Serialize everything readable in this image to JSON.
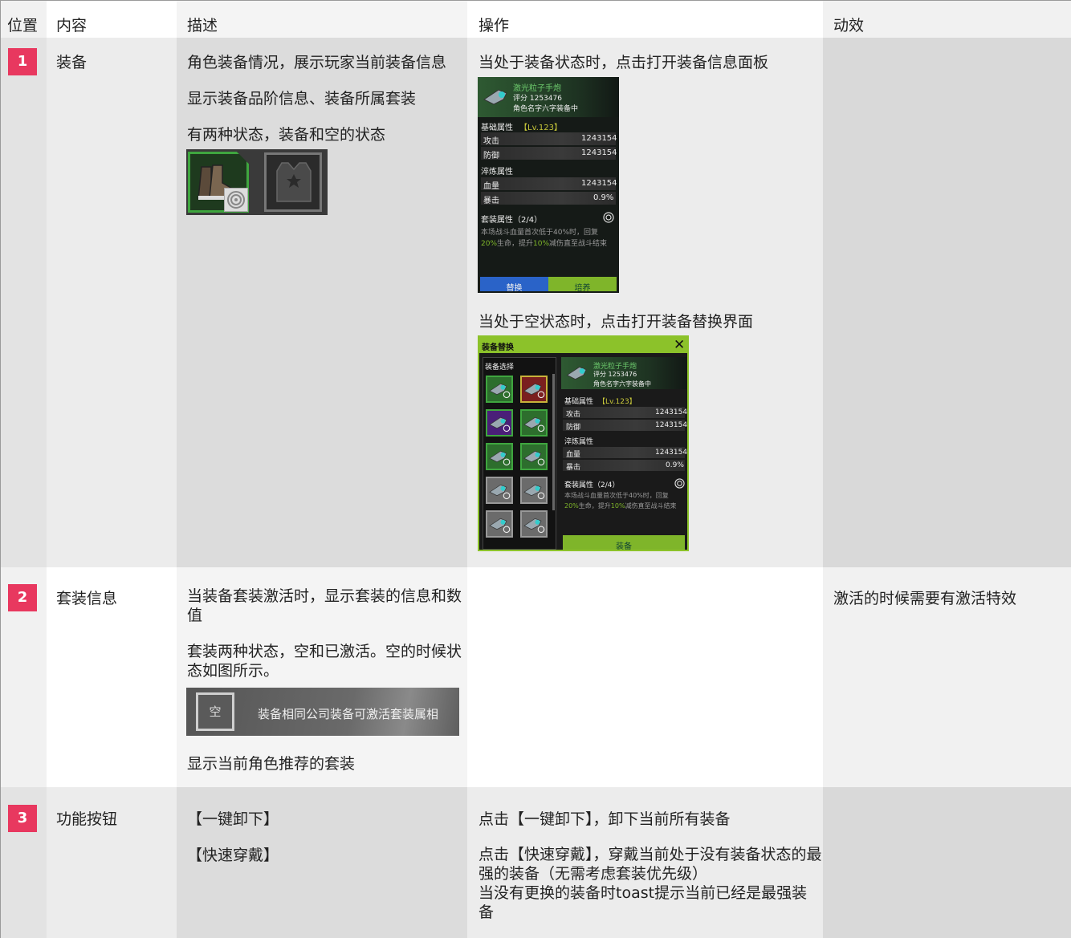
{
  "header": {
    "pos": "位置",
    "content": "内容",
    "desc": "描述",
    "op": "操作",
    "anim": "动效"
  },
  "rows": [
    {
      "num": "1",
      "content": "装备",
      "desc": [
        "角色装备情况，展示玩家当前装备信息",
        "显示装备品阶信息、装备所属套装",
        "有两种状态，装备和空的状态"
      ],
      "op": [
        "当处于装备状态时，点击打开装备信息面板",
        "当处于空状态时，点击打开装备替换界面"
      ],
      "anim": ""
    },
    {
      "num": "2",
      "content": "套装信息",
      "desc": [
        "当装备套装激活时，显示套装的信息和数值",
        "套装两种状态，空和已激活。空的时候状态如图所示。",
        "显示当前角色推荐的套装"
      ],
      "op": [],
      "anim": "激活的时候需要有激活特效"
    },
    {
      "num": "3",
      "content": "功能按钮",
      "desc": [
        "【一键卸下】",
        "【快速穿戴】"
      ],
      "op": [
        "点击【一键卸下】，卸下当前所有装备",
        "点击【快速穿戴】，穿戴当前处于没有装备状态的最强的装备（无需考虑套装优先级）",
        "当没有更换的装备时toast提示当前已经是最强装备"
      ],
      "anim": ""
    }
  ],
  "info_panel": {
    "item_name": "激光粒子手炮",
    "score": "评分 1253476",
    "equipped_by": "角色名字六字装备中",
    "base_title": "基础属性",
    "base_level": "【Lv.123】",
    "stats": [
      {
        "label": "攻击",
        "value": "1243154"
      },
      {
        "label": "防御",
        "value": "1243154"
      }
    ],
    "refine_title": "淬炼属性",
    "refine_stats": [
      {
        "label": "血量",
        "value": "1243154"
      },
      {
        "label": "暴击",
        "value": "0.9%"
      }
    ],
    "set_title": "套装属性（2/4）",
    "set_desc_1": "本场战斗血量首次低于40%时，回复",
    "set_desc_2a": "20%",
    "set_desc_2b": "生命，提升",
    "set_desc_2c": "10%",
    "set_desc_2d": "减伤直至战斗结束",
    "btn_replace": "替换",
    "btn_train": "培养",
    "colors": {
      "replace": "#2a63c8",
      "train": "#7fb52a"
    }
  },
  "replace_panel": {
    "title": "装备替换",
    "list_title": "装备选择",
    "item_name": "激光粒子手炮",
    "score": "评分 1253476",
    "equipped_by": "角色名字六字装备中",
    "base_title": "基础属性",
    "base_level": "【Lv.123】",
    "stats": [
      {
        "label": "攻击",
        "value": "1243154"
      },
      {
        "label": "防御",
        "value": "1243154"
      }
    ],
    "refine_title": "淬炼属性",
    "refine_stats": [
      {
        "label": "血量",
        "value": "1243154"
      },
      {
        "label": "暴击",
        "value": "0.9%"
      }
    ],
    "set_title": "套装属性（2/4）",
    "set_desc_1": "本场战斗血量首次低于40%时，回复",
    "set_desc_2a": "20%",
    "set_desc_2b": "生命，提升",
    "set_desc_2c": "10%",
    "set_desc_2d": "减伤直至战斗结束",
    "btn_equip": "装备",
    "slots": [
      "green",
      "red",
      "purple",
      "green",
      "green",
      "green",
      "gray",
      "gray",
      "gray",
      "gray"
    ],
    "colors": {
      "header": "#8cc22a",
      "green": "#2d6e2d",
      "red": "#7a1f1f",
      "purple": "#4a1f78",
      "gray": "#6b6b6b"
    }
  },
  "set_bar": {
    "empty_label": "空",
    "text": "装备相同公司装备可激活套装属相"
  }
}
